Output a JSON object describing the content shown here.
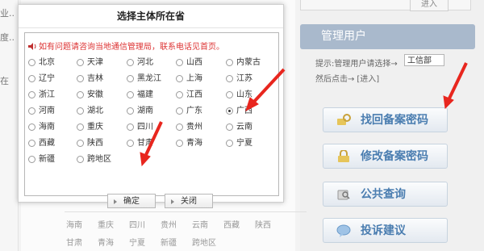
{
  "background": {
    "left_fragments": [
      "业..",
      "度..",
      "在"
    ],
    "top_enter_label": "进入",
    "manage_users_title": "管理用户",
    "hint_line1": "提示:管理用户请选择→",
    "department_select": "工信部",
    "hint_line2": "然后点击→",
    "hint_enter_link": "进入",
    "buttons": [
      {
        "label": "找回备案密码"
      },
      {
        "label": "修改备案密码"
      },
      {
        "label": "公共查询"
      },
      {
        "label": "投诉建议"
      }
    ],
    "province_rows": [
      [
        "海南",
        "重庆",
        "四川",
        "贵州",
        "云南",
        "西藏",
        "陕西"
      ],
      [
        "甘肃",
        "青海",
        "宁夏",
        "新疆",
        "跨地区"
      ]
    ]
  },
  "dialog": {
    "title": "选择主体所在省",
    "notice": "如有问题请咨询当地通信管理局，联系电话见首页。",
    "provinces": [
      [
        "北京",
        "天津",
        "河北",
        "山西",
        "内蒙古"
      ],
      [
        "辽宁",
        "吉林",
        "黑龙江",
        "上海",
        "江苏"
      ],
      [
        "浙江",
        "安徽",
        "福建",
        "江西",
        "山东"
      ],
      [
        "河南",
        "湖北",
        "湖南",
        "广东",
        "广西"
      ],
      [
        "海南",
        "重庆",
        "四川",
        "贵州",
        "云南"
      ],
      [
        "西藏",
        "陕西",
        "甘肃",
        "青海",
        "宁夏"
      ],
      [
        "新疆",
        "跨地区"
      ]
    ],
    "selected": "广西",
    "confirm_label": "确定",
    "close_label": "关闭"
  },
  "colors": {
    "accent": "#4a7db0",
    "notice": "#d33333",
    "arrow": "#e8261e",
    "header": "#a9b9cc"
  }
}
